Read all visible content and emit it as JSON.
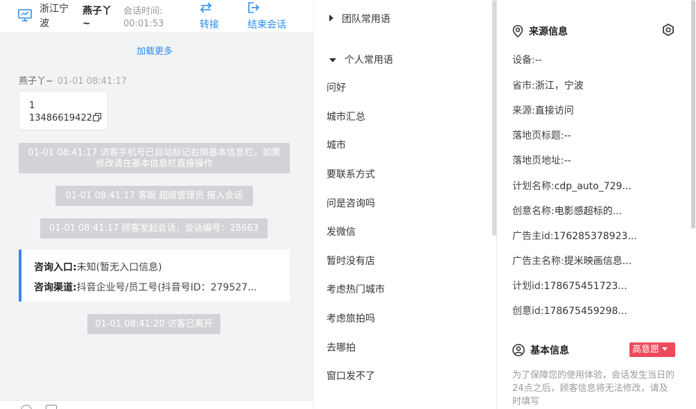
{
  "header": {
    "location": "浙江宁波",
    "visitor_name": "燕子丫~",
    "session_time_label": "会话时间:",
    "session_time": "00:01:53",
    "transfer_label": "转接",
    "end_label": "结束会话"
  },
  "chat": {
    "load_more": "加载更多",
    "visitor_name": "燕子丫~",
    "visitor_time": "01-01 08:41:17",
    "message_line1": "1",
    "message_line2": "13486619422",
    "system": [
      "01-01 08:41:17 访客手机号已自动标记右侧基本信息栏，如需修改请在基本信息栏直接操作",
      "01-01 08:41:17 客服 超级管理员 接入会话",
      "01-01 08:41:17 顾客发起会话，会话编号：28663",
      "01-01 08:41:20 访客已离开"
    ],
    "entry_label": "咨询入口:",
    "entry_value": "未知(暂无入口信息)",
    "channel_label": "咨询渠道:",
    "channel_value": "抖音企业号/员工号(抖音号ID：279527..."
  },
  "phrases": {
    "team_group": "团队常用语",
    "personal_group": "个人常用语",
    "items": [
      "问好",
      "城市汇总",
      "城市",
      "要联系方式",
      "问是咨询吗",
      "发微信",
      "暂时没有店",
      "考虑热门城市",
      "考虑旅拍吗",
      "去哪拍",
      "窗口发不了"
    ]
  },
  "source": {
    "title": "来源信息",
    "rows": [
      {
        "label": "设备:",
        "value": "--"
      },
      {
        "label": "省市:",
        "value": "浙江，宁波"
      },
      {
        "label": "来源:",
        "value": "直接访问"
      },
      {
        "label": "落地页标题:",
        "value": "--"
      },
      {
        "label": "落地页地址:",
        "value": "--"
      },
      {
        "label": "计划名称:",
        "value": "cdp_auto_729..."
      },
      {
        "label": "创意名称:",
        "value": "电影感超标的..."
      },
      {
        "label": "广告主id:",
        "value": "176285378923..."
      },
      {
        "label": "广告主名称:",
        "value": "提米映画信息..."
      },
      {
        "label": "计划id:",
        "value": "178675451723..."
      },
      {
        "label": "创意id:",
        "value": "178675459298..."
      }
    ]
  },
  "basic": {
    "title": "基本信息",
    "intent_badge": "高意愿",
    "notice": "为了保障您的使用体验，会话发生当日的24点之后，顾客信息将无法修改，请及时填写"
  },
  "colors": {
    "accent": "#2d8cf0",
    "system_bg": "#d2d3d6",
    "badge": "#ef4a5a",
    "card_border": "#3e86e6"
  }
}
